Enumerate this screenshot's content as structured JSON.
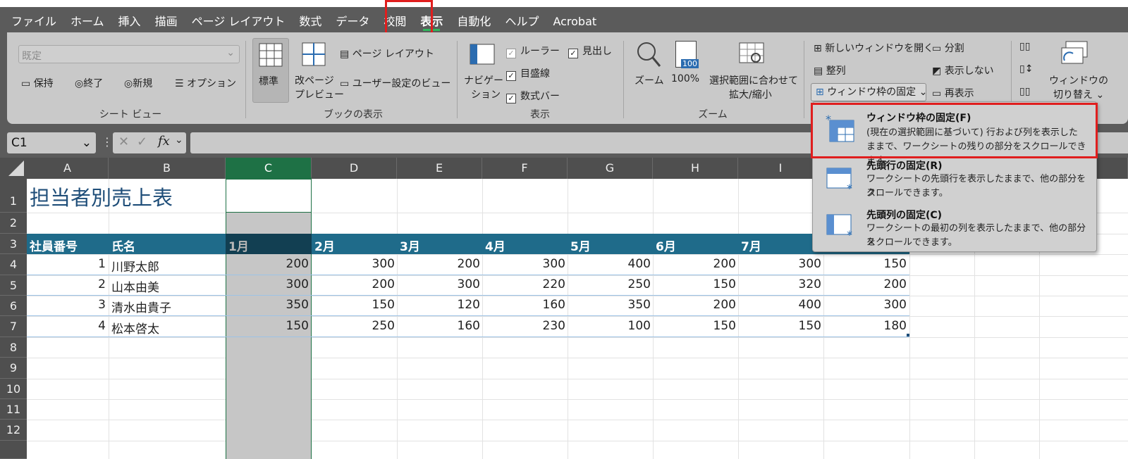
{
  "menu": {
    "tabs": [
      "ファイル",
      "ホーム",
      "挿入",
      "描画",
      "ページ レイアウト",
      "数式",
      "データ",
      "校閲",
      "表示",
      "自動化",
      "ヘルプ",
      "Acrobat"
    ],
    "active_tab": "表示"
  },
  "ribbon": {
    "sheet_view": {
      "select_value": "既定",
      "keep": "保持",
      "exit": "終了",
      "new": "新規",
      "options": "オプション",
      "label": "シート ビュー"
    },
    "book_view": {
      "normal": "標準",
      "page_break_l1": "改ページ",
      "page_break_l2": "プレビュー",
      "page_layout": "ページ レイアウト",
      "custom_views": "ユーザー設定のビュー",
      "label": "ブックの表示"
    },
    "show": {
      "navigation_l1": "ナビゲー",
      "navigation_l2": "ション",
      "ruler": "ルーラー",
      "gridlines": "目盛線",
      "formula_bar": "数式バー",
      "headings": "見出し",
      "label": "表示"
    },
    "zoom": {
      "zoom": "ズーム",
      "hundred": "100%",
      "fit_l1": "選択範囲に合わせて",
      "fit_l2": "拡大/縮小",
      "icon_text": "100",
      "label": "ズーム"
    },
    "window": {
      "new_window": "新しいウィンドウを開く",
      "arrange": "整列",
      "freeze": "ウィンドウ枠の固定",
      "split": "分割",
      "hide": "表示しない",
      "unhide": "再表示",
      "switch_l1": "ウィンドウの",
      "switch_l2": "切り替え"
    }
  },
  "formula_bar": {
    "name_box": "C1",
    "fx": "fx"
  },
  "sheet": {
    "columns": [
      "A",
      "B",
      "C",
      "D",
      "E",
      "F",
      "G",
      "H",
      "I"
    ],
    "rows": [
      "1",
      "2",
      "3",
      "4",
      "5",
      "6",
      "7",
      "8",
      "9",
      "10",
      "11",
      "12"
    ],
    "title": "担当者別売上表",
    "headers": [
      "社員番号",
      "氏名",
      "1月",
      "2月",
      "3月",
      "4月",
      "5月",
      "6月",
      "7月"
    ],
    "data": [
      {
        "id": "1",
        "name": "川野太郎",
        "m": [
          "200",
          "300",
          "200",
          "300",
          "400",
          "200",
          "300",
          "150"
        ]
      },
      {
        "id": "2",
        "name": "山本由美",
        "m": [
          "300",
          "200",
          "300",
          "220",
          "250",
          "150",
          "320",
          "200"
        ]
      },
      {
        "id": "3",
        "name": "清水由貴子",
        "m": [
          "350",
          "150",
          "120",
          "160",
          "350",
          "200",
          "400",
          "300"
        ]
      },
      {
        "id": "4",
        "name": "松本啓太",
        "m": [
          "150",
          "250",
          "160",
          "230",
          "100",
          "150",
          "150",
          "180"
        ]
      }
    ]
  },
  "dropdown": {
    "items": [
      {
        "title": "ウィンドウ枠の固定(F)",
        "desc1": "(現在の選択範囲に基づいて) 行および列を表示した",
        "desc2": "ままで、ワークシートの残りの部分をスクロールできます。"
      },
      {
        "title": "先頭行の固定(R)",
        "desc1": "ワークシートの先頭行を表示したままで、他の部分をス",
        "desc2": "クロールできます。"
      },
      {
        "title": "先頭列の固定(C)",
        "desc1": "ワークシートの最初の列を表示したままで、他の部分を",
        "desc2": "スクロールできます。"
      }
    ]
  },
  "colors": {
    "accent": "#1e7145",
    "header_fill": "#1f6b8a",
    "highlight": "#e01e1e"
  }
}
